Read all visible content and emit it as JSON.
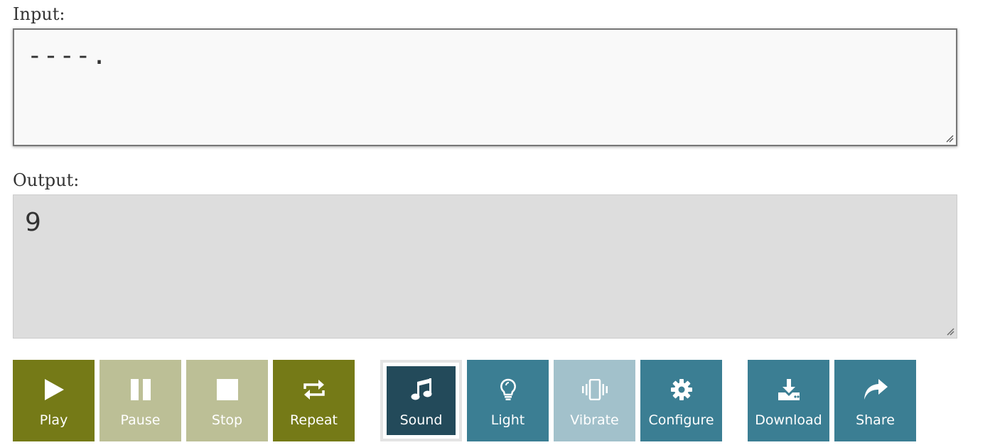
{
  "input": {
    "label": "Input:",
    "value": "----."
  },
  "output": {
    "label": "Output:",
    "value": "9"
  },
  "playback": {
    "play": {
      "label": "Play",
      "icon": "play-icon"
    },
    "pause": {
      "label": "Pause",
      "icon": "pause-icon"
    },
    "stop": {
      "label": "Stop",
      "icon": "stop-icon"
    },
    "repeat": {
      "label": "Repeat",
      "icon": "repeat-icon"
    }
  },
  "modes": {
    "sound": {
      "label": "Sound",
      "icon": "music-note-icon"
    },
    "light": {
      "label": "Light",
      "icon": "lightbulb-icon"
    },
    "vibrate": {
      "label": "Vibrate",
      "icon": "vibrate-icon"
    },
    "configure": {
      "label": "Configure",
      "icon": "gear-icon"
    }
  },
  "actions": {
    "download": {
      "label": "Download",
      "icon": "download-icon"
    },
    "share": {
      "label": "Share",
      "icon": "share-icon"
    }
  },
  "colors": {
    "olive": "#757a17",
    "olive_disabled": "#bcbf96",
    "teal": "#3b7e93",
    "teal_disabled": "#a2c1cb",
    "teal_active": "#234a5a",
    "output_bg": "#dddddd"
  }
}
